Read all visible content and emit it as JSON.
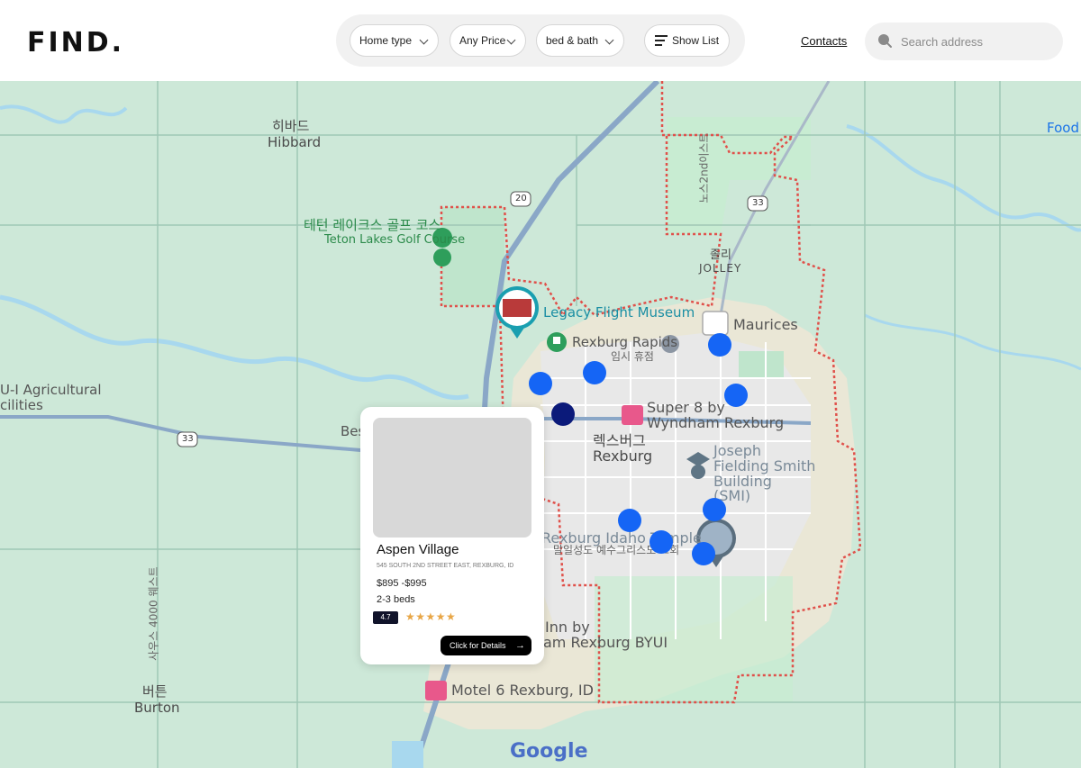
{
  "header": {
    "logo": "FIND.",
    "filters": {
      "home_type": "Home type",
      "price": "Any Price",
      "bed_bath": "bed & bath",
      "show_list": "Show List"
    },
    "contacts": "Contacts",
    "search": {
      "placeholder": "Search address"
    }
  },
  "map": {
    "labels": {
      "hibbard_ko": "히바드",
      "hibbard": "Hibbard",
      "golf_ko": "테턴 레이크스 골프 코스",
      "golf": "Teton Lakes Golf Course",
      "museum": "Legacy Flight Museum",
      "rapids": "Rexburg Rapids",
      "rapids_ko": "임시 휴점",
      "maurices": "Maurices",
      "jolley_ko": "졸리",
      "jolley": "JOLLEY",
      "north2nd": "노스2nd이스트",
      "super8_1": "Super 8 by",
      "super8_2": "Wyndham Rexburg",
      "rexburg_ko": "렉스버그",
      "rexburg": "Rexburg",
      "joseph_1": "Joseph",
      "joseph_2": "Fielding Smith",
      "joseph_3": "Building",
      "joseph_4": "(SMI)",
      "temple": "Rexburg Idaho Temple",
      "temple_ko": "말일성도 예수그리스도 교회",
      "inn_1": "Inn by",
      "inn_2": "am Rexburg BYUI",
      "motel6": "Motel 6 Rexburg, ID",
      "agri_1": "U-I Agricultural",
      "agri_2": "cilities",
      "bes": "Bes",
      "burton_ko": "버튼",
      "burton": "Burton",
      "south4000": "사우스 4000 웨스트",
      "food": "Food",
      "route20": "20",
      "route33a": "33",
      "route33b": "33",
      "google": "Google"
    }
  },
  "card": {
    "title": "Aspen Village",
    "address": "545 SOUTH 2ND STREET EAST, REXBURG, ID",
    "price": "$895 -$995",
    "beds": "2-3 beds",
    "rating": "4.7",
    "stars": "★★★★★",
    "button": "Click for Details"
  }
}
